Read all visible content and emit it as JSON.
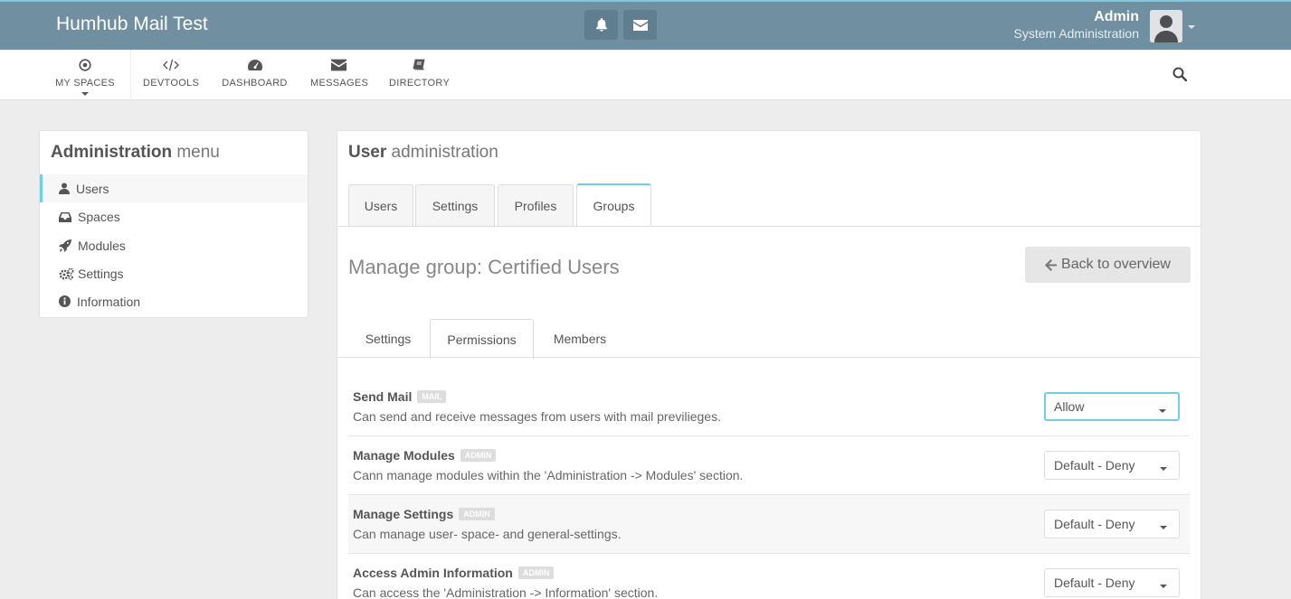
{
  "app": {
    "title": "Humhub Mail Test"
  },
  "user": {
    "name": "Admin",
    "role": "System Administration"
  },
  "nav": {
    "items": [
      {
        "label": "MY SPACES",
        "icon": "dot-circle-icon"
      },
      {
        "label": "DEVTOOLS",
        "icon": "code-icon"
      },
      {
        "label": "DASHBOARD",
        "icon": "dashboard-icon"
      },
      {
        "label": "MESSAGES",
        "icon": "envelope-icon"
      },
      {
        "label": "DIRECTORY",
        "icon": "book-icon"
      }
    ]
  },
  "admin_menu": {
    "title_bold": "Administration",
    "title_light": "menu",
    "items": [
      {
        "label": "Users",
        "icon": "user-icon",
        "active": true
      },
      {
        "label": "Spaces",
        "icon": "inbox-icon"
      },
      {
        "label": "Modules",
        "icon": "rocket-icon"
      },
      {
        "label": "Settings",
        "icon": "gears-icon"
      },
      {
        "label": "Information",
        "icon": "info-circle-icon"
      }
    ]
  },
  "main": {
    "title_bold": "User",
    "title_light": "administration",
    "tabs": [
      {
        "label": "Users"
      },
      {
        "label": "Settings"
      },
      {
        "label": "Profiles"
      },
      {
        "label": "Groups",
        "active": true
      }
    ],
    "manage_title": "Manage group: Certified Users",
    "back_label": "Back to overview",
    "subtabs": [
      {
        "label": "Settings"
      },
      {
        "label": "Permissions",
        "active": true
      },
      {
        "label": "Members"
      }
    ],
    "permissions": [
      {
        "name": "Send Mail",
        "badge": "MAIL",
        "description": "Can send and receive messages from users with mail previlieges.",
        "value": "Allow"
      },
      {
        "name": "Manage Modules",
        "badge": "ADMIN",
        "description": "Cann manage modules within the 'Administration -> Modules' section.",
        "value": "Default - Deny"
      },
      {
        "name": "Manage Settings",
        "badge": "ADMIN",
        "description": "Can manage user- space- and general-settings.",
        "value": "Default - Deny"
      },
      {
        "name": "Access Admin Information",
        "badge": "ADMIN",
        "description": "Can access the 'Administration -> Information' section.",
        "value": "Default - Deny"
      }
    ]
  },
  "colors": {
    "topbar": "#708fa0",
    "accent": "#6fcfe5"
  }
}
